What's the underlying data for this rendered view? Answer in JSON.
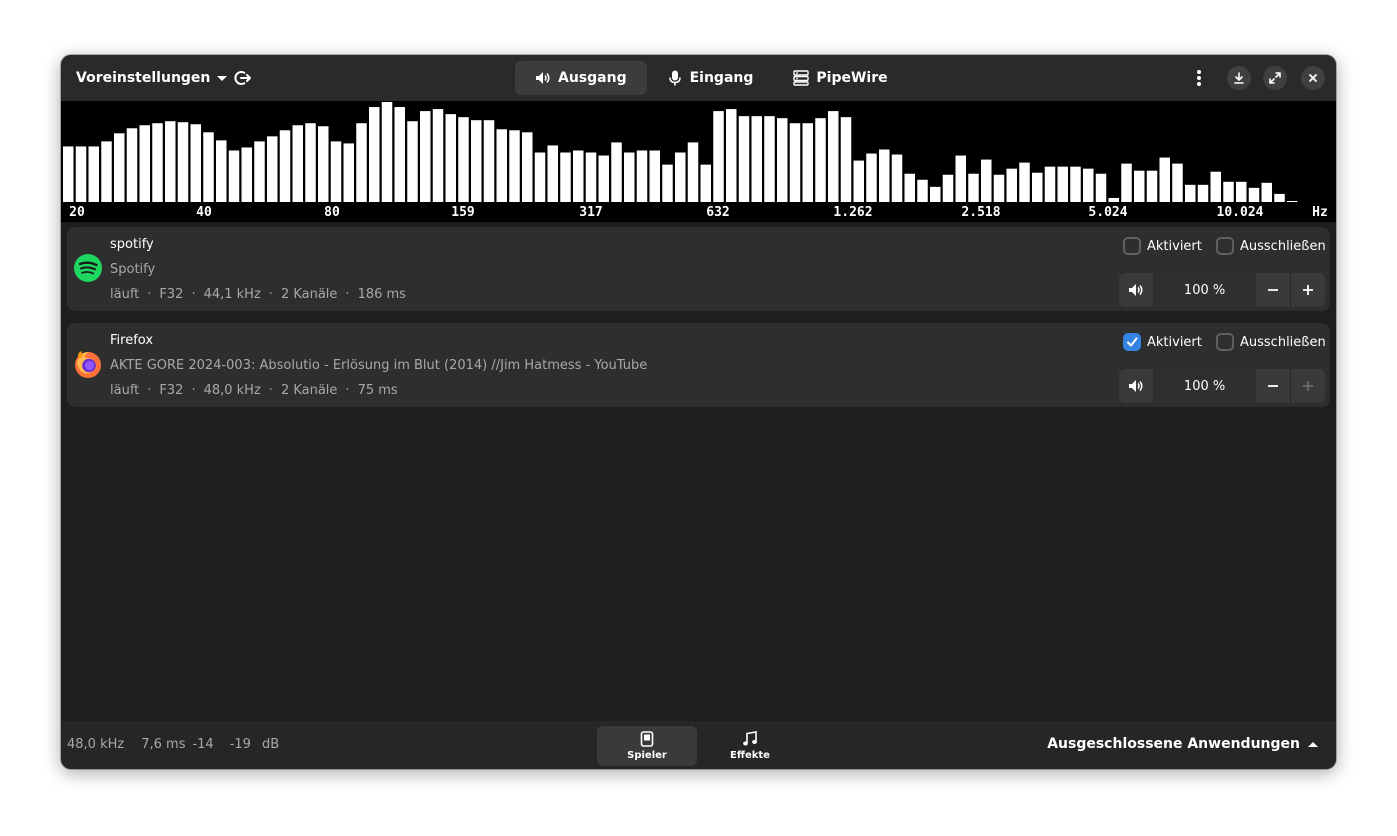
{
  "header": {
    "presets_label": "Voreinstellungen",
    "tabs": [
      {
        "label": "Ausgang",
        "icon": "speaker-icon",
        "active": true
      },
      {
        "label": "Eingang",
        "icon": "microphone-icon",
        "active": false
      },
      {
        "label": "PipeWire",
        "icon": "pipewire-icon",
        "active": false
      }
    ]
  },
  "spectrum": {
    "unit": "Hz",
    "freq_labels": [
      "20",
      "40",
      "80",
      "159",
      "317",
      "632",
      "1.262",
      "2.518",
      "5.024",
      "10.024"
    ],
    "levels": [
      0.55,
      0.55,
      0.55,
      0.6,
      0.68,
      0.73,
      0.76,
      0.78,
      0.8,
      0.79,
      0.77,
      0.69,
      0.61,
      0.51,
      0.54,
      0.6,
      0.65,
      0.71,
      0.76,
      0.78,
      0.75,
      0.6,
      0.58,
      0.78,
      0.94,
      0.99,
      0.94,
      0.8,
      0.9,
      0.92,
      0.87,
      0.84,
      0.81,
      0.81,
      0.72,
      0.71,
      0.69,
      0.49,
      0.56,
      0.49,
      0.51,
      0.49,
      0.46,
      0.59,
      0.49,
      0.51,
      0.51,
      0.37,
      0.49,
      0.59,
      0.37,
      0.9,
      0.92,
      0.85,
      0.85,
      0.85,
      0.83,
      0.78,
      0.78,
      0.83,
      0.9,
      0.84,
      0.41,
      0.48,
      0.52,
      0.47,
      0.28,
      0.22,
      0.15,
      0.27,
      0.46,
      0.28,
      0.42,
      0.27,
      0.33,
      0.39,
      0.29,
      0.35,
      0.35,
      0.35,
      0.33,
      0.28,
      0.04,
      0.38,
      0.31,
      0.31,
      0.44,
      0.38,
      0.17,
      0.17,
      0.3,
      0.2,
      0.2,
      0.14,
      0.19,
      0.08,
      0.01
    ]
  },
  "streams": [
    {
      "app_name": "spotify",
      "media_title": "Spotify",
      "icon": "spotify-icon",
      "info": [
        "läuft",
        "F32",
        "44,1 kHz",
        "2 Kanäle",
        "186 ms"
      ],
      "enabled": false,
      "enabled_label": "Aktiviert",
      "exclude_label": "Ausschließen",
      "volume": "100 %"
    },
    {
      "app_name": "Firefox",
      "media_title": "AKTE GORE 2024-003: Absolutio - Erlösung im Blut (2014) //Jim Hatmess - YouTube",
      "icon": "firefox-icon",
      "info": [
        "läuft",
        "F32",
        "48,0 kHz",
        "2 Kanäle",
        "75 ms"
      ],
      "enabled": true,
      "enabled_label": "Aktiviert",
      "exclude_label": "Ausschließen",
      "volume": "100 %"
    }
  ],
  "statusbar": {
    "sample_rate": "48,0 kHz",
    "latency": "7,6 ms",
    "level_left": "-14",
    "level_right": "-19",
    "level_unit": "dB",
    "tabs": [
      {
        "label": "Spieler",
        "icon": "player-icon",
        "active": true
      },
      {
        "label": "Effekte",
        "icon": "music-note-icon",
        "active": false
      }
    ],
    "excluded_label": "Ausgeschlossene Anwendungen"
  },
  "colors": {
    "accent": "#3584e4",
    "spotify": "#1ed760",
    "window_bg": "#1e1e1e",
    "card_bg": "#2e2e2e"
  }
}
